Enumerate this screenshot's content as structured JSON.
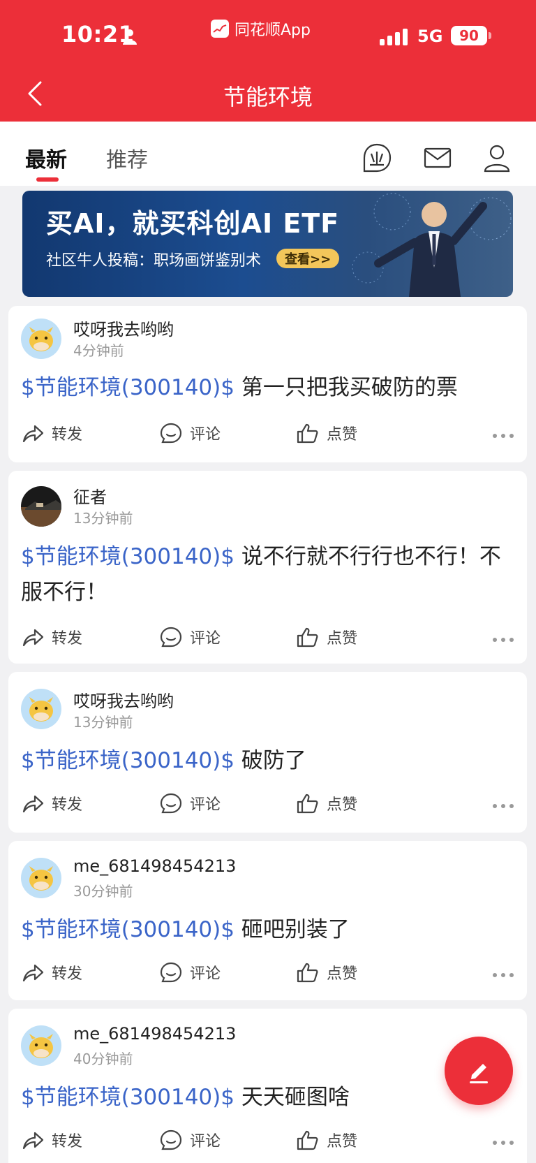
{
  "status_bar": {
    "time": "10:21",
    "app_name": "同花顺App",
    "network": "5G",
    "battery": "90"
  },
  "header": {
    "title": "节能环境"
  },
  "tabs": [
    {
      "label": "最新"
    },
    {
      "label": "推荐"
    }
  ],
  "header_icons": [
    "topic-icon",
    "mail-icon",
    "profile-icon"
  ],
  "banner": {
    "title": "买AI，就买科创AI ETF",
    "subtitle": "社区牛人投稿：职场画饼鉴别术",
    "button": "查看>>"
  },
  "actions": {
    "share": "转发",
    "comment": "评论",
    "like": "点赞"
  },
  "posts": [
    {
      "user": "哎呀我去哟哟",
      "time": "4分钟前",
      "stock": "$节能环境(300140)$",
      "text": " 第一只把我买破防的票"
    },
    {
      "user": "征者",
      "time": "13分钟前",
      "stock": "$节能环境(300140)$",
      "text": " 说不行就不行行也不行！不服不行！"
    },
    {
      "user": "哎呀我去哟哟",
      "time": "13分钟前",
      "stock": "$节能环境(300140)$",
      "text": " 破防了"
    },
    {
      "user": "me_681498454213",
      "time": "30分钟前",
      "stock": "$节能环境(300140)$",
      "text": " 砸吧别装了"
    },
    {
      "user": "me_681498454213",
      "time": "40分钟前",
      "stock": "$节能环境(300140)$",
      "text": " 天天砸图啥"
    }
  ],
  "colors": {
    "brand_red": "#ec2f39",
    "link_blue": "#3a64c8"
  }
}
